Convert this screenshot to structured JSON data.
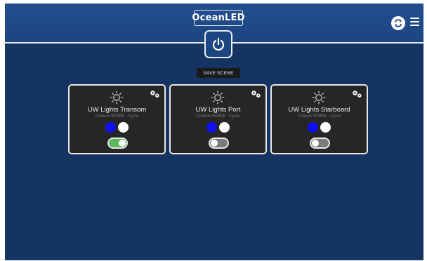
{
  "header": {
    "logo_ocean": "Ocean",
    "logo_led": "LED"
  },
  "icons": {
    "power": "power-icon",
    "sync": "sync-icon",
    "menu": "hamburger-menu-icon",
    "brightness": "sun-icon",
    "settings": "gears-icon"
  },
  "toolbar": {
    "save_scene_label": "SAVE SCENE"
  },
  "colors": {
    "background": "#163461",
    "header": "#1c4581",
    "card": "#262626",
    "toggle_on": "#5cb85c",
    "toggle_off": "#7a7a7a",
    "swatch_blue": "#1010ee",
    "swatch_white": "#ffffff"
  },
  "cards": [
    {
      "name": "UW Lights Transom",
      "subtitle": "Colours RGBW - Cycle",
      "swatches": [
        "blue",
        "white"
      ],
      "enabled": true
    },
    {
      "name": "UW Lights Port",
      "subtitle": "Colours RGBW - Cycle",
      "swatches": [
        "blue",
        "white"
      ],
      "enabled": false
    },
    {
      "name": "UW Lights Starboard",
      "subtitle": "Colours RGBW - Cycle",
      "swatches": [
        "blue",
        "white"
      ],
      "enabled": false
    }
  ]
}
